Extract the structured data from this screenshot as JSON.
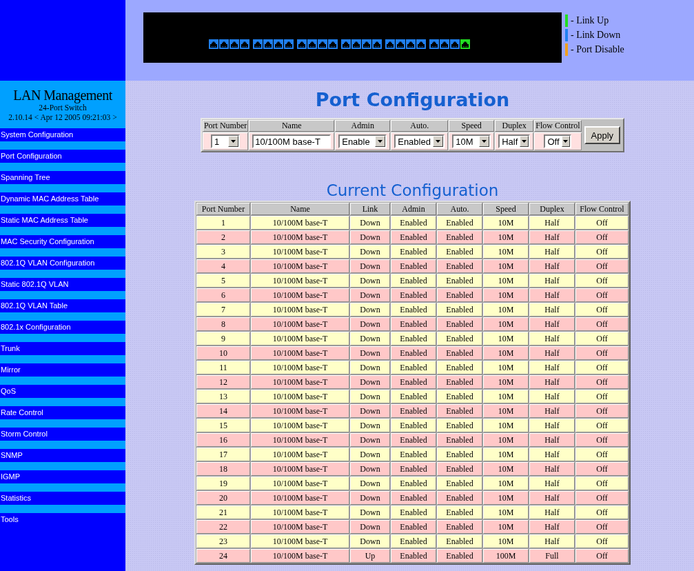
{
  "switch_panel": {
    "ports": [
      {
        "color": "#2080f0"
      },
      {
        "color": "#2080f0"
      },
      {
        "color": "#2080f0"
      },
      {
        "color": "#2080f0"
      },
      {
        "color": "#2080f0"
      },
      {
        "color": "#2080f0"
      },
      {
        "color": "#2080f0"
      },
      {
        "color": "#2080f0"
      },
      {
        "color": "#2080f0"
      },
      {
        "color": "#2080f0"
      },
      {
        "color": "#2080f0"
      },
      {
        "color": "#2080f0"
      },
      {
        "color": "#2080f0"
      },
      {
        "color": "#2080f0"
      },
      {
        "color": "#2080f0"
      },
      {
        "color": "#2080f0"
      },
      {
        "color": "#2080f0"
      },
      {
        "color": "#2080f0"
      },
      {
        "color": "#2080f0"
      },
      {
        "color": "#2080f0"
      },
      {
        "color": "#2080f0"
      },
      {
        "color": "#2080f0"
      },
      {
        "color": "#2080f0"
      },
      {
        "color": "#22dd22"
      }
    ]
  },
  "legend": [
    {
      "label": "- Link Up",
      "color": "#22dd22"
    },
    {
      "label": "- Link Down",
      "color": "#2080f0"
    },
    {
      "label": "- Port Disable",
      "color": "#f0a020"
    }
  ],
  "sidebar": {
    "title": "LAN Management",
    "subtitle": "24-Port Switch",
    "version": "2.10.14 < Apr 12 2005 09:21:03 >",
    "items": [
      "System Configuration",
      "Port Configuration",
      "Spanning Tree",
      "Dynamic MAC Address Table",
      "Static MAC Address Table",
      "MAC Security Configuration",
      "802.1Q VLAN Configuration",
      "Static 802.1Q VLAN",
      "802.1Q VLAN Table",
      "802.1x Configuration",
      "Trunk",
      "Mirror",
      "QoS",
      "Rate Control",
      "Storm Control",
      "SNMP",
      "IGMP",
      "Statistics",
      "Tools"
    ]
  },
  "page_title": "Port Configuration",
  "form": {
    "fields": [
      {
        "label": "Port Number",
        "kind": "select",
        "value": "1"
      },
      {
        "label": "Name",
        "kind": "input",
        "value": "10/100M base-T"
      },
      {
        "label": "Admin",
        "kind": "select",
        "value": "Enable"
      },
      {
        "label": "Auto.",
        "kind": "select",
        "value": "Enabled"
      },
      {
        "label": "Speed",
        "kind": "select",
        "value": "10M"
      },
      {
        "label": "Duplex",
        "kind": "select",
        "value": "Half"
      },
      {
        "label": "Flow Control",
        "kind": "select",
        "value": "Off"
      }
    ],
    "apply": "Apply"
  },
  "current_title": "Current Configuration",
  "table": {
    "columns": [
      "Port Number",
      "Name",
      "Link",
      "Admin",
      "Auto.",
      "Speed",
      "Duplex",
      "Flow Control"
    ],
    "rows": [
      [
        "1",
        "10/100M base-T",
        "Down",
        "Enabled",
        "Enabled",
        "10M",
        "Half",
        "Off"
      ],
      [
        "2",
        "10/100M base-T",
        "Down",
        "Enabled",
        "Enabled",
        "10M",
        "Half",
        "Off"
      ],
      [
        "3",
        "10/100M base-T",
        "Down",
        "Enabled",
        "Enabled",
        "10M",
        "Half",
        "Off"
      ],
      [
        "4",
        "10/100M base-T",
        "Down",
        "Enabled",
        "Enabled",
        "10M",
        "Half",
        "Off"
      ],
      [
        "5",
        "10/100M base-T",
        "Down",
        "Enabled",
        "Enabled",
        "10M",
        "Half",
        "Off"
      ],
      [
        "6",
        "10/100M base-T",
        "Down",
        "Enabled",
        "Enabled",
        "10M",
        "Half",
        "Off"
      ],
      [
        "7",
        "10/100M base-T",
        "Down",
        "Enabled",
        "Enabled",
        "10M",
        "Half",
        "Off"
      ],
      [
        "8",
        "10/100M base-T",
        "Down",
        "Enabled",
        "Enabled",
        "10M",
        "Half",
        "Off"
      ],
      [
        "9",
        "10/100M base-T",
        "Down",
        "Enabled",
        "Enabled",
        "10M",
        "Half",
        "Off"
      ],
      [
        "10",
        "10/100M base-T",
        "Down",
        "Enabled",
        "Enabled",
        "10M",
        "Half",
        "Off"
      ],
      [
        "11",
        "10/100M base-T",
        "Down",
        "Enabled",
        "Enabled",
        "10M",
        "Half",
        "Off"
      ],
      [
        "12",
        "10/100M base-T",
        "Down",
        "Enabled",
        "Enabled",
        "10M",
        "Half",
        "Off"
      ],
      [
        "13",
        "10/100M base-T",
        "Down",
        "Enabled",
        "Enabled",
        "10M",
        "Half",
        "Off"
      ],
      [
        "14",
        "10/100M base-T",
        "Down",
        "Enabled",
        "Enabled",
        "10M",
        "Half",
        "Off"
      ],
      [
        "15",
        "10/100M base-T",
        "Down",
        "Enabled",
        "Enabled",
        "10M",
        "Half",
        "Off"
      ],
      [
        "16",
        "10/100M base-T",
        "Down",
        "Enabled",
        "Enabled",
        "10M",
        "Half",
        "Off"
      ],
      [
        "17",
        "10/100M base-T",
        "Down",
        "Enabled",
        "Enabled",
        "10M",
        "Half",
        "Off"
      ],
      [
        "18",
        "10/100M base-T",
        "Down",
        "Enabled",
        "Enabled",
        "10M",
        "Half",
        "Off"
      ],
      [
        "19",
        "10/100M base-T",
        "Down",
        "Enabled",
        "Enabled",
        "10M",
        "Half",
        "Off"
      ],
      [
        "20",
        "10/100M base-T",
        "Down",
        "Enabled",
        "Enabled",
        "10M",
        "Half",
        "Off"
      ],
      [
        "21",
        "10/100M base-T",
        "Down",
        "Enabled",
        "Enabled",
        "10M",
        "Half",
        "Off"
      ],
      [
        "22",
        "10/100M base-T",
        "Down",
        "Enabled",
        "Enabled",
        "10M",
        "Half",
        "Off"
      ],
      [
        "23",
        "10/100M base-T",
        "Down",
        "Enabled",
        "Enabled",
        "10M",
        "Half",
        "Off"
      ],
      [
        "24",
        "10/100M base-T",
        "Up",
        "Enabled",
        "Enabled",
        "100M",
        "Full",
        "Off"
      ]
    ]
  }
}
